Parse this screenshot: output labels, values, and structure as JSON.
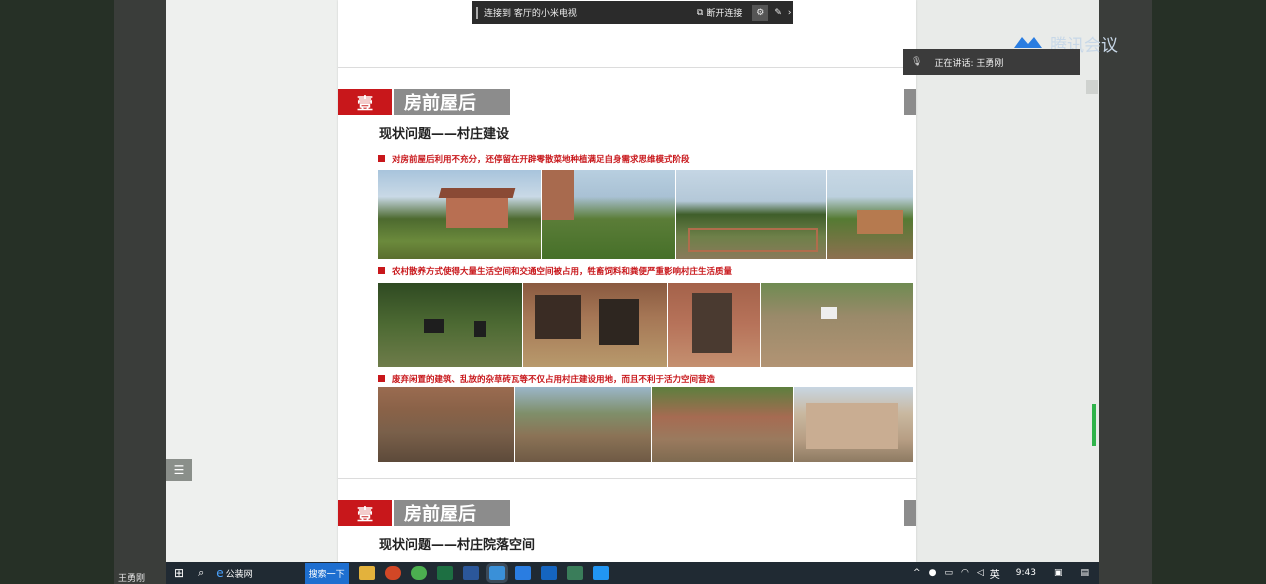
{
  "cast_bar": {
    "label": "连接到 客厅的小米电视",
    "disconnect": "断开连接"
  },
  "meeting": {
    "brand": "腾讯会议",
    "speaking_label": "正在讲话: 王勇刚",
    "user_name": "王勇刚"
  },
  "slides": [
    {
      "badge": "壹",
      "title": "房前屋后",
      "subtitle": "现状问题——村庄建设",
      "bullets": [
        "对房前屋后利用不充分，还停留在开辟零散菜地种植满足自身需求思维模式阶段",
        "农村散养方式使得大量生活空间和交通空间被占用，牲畜饲料和粪便严重影响村庄生活质量",
        "废弃闲置的建筑、乱放的杂草砖瓦等不仅占用村庄建设用地，而且不利于活力空间营造"
      ]
    },
    {
      "badge": "壹",
      "title": "房前屋后",
      "subtitle": "现状问题——村庄院落空间"
    }
  ],
  "taskbar": {
    "browser_label": "公装网",
    "search_button": "搜索一下",
    "ime": "英",
    "time": "9:43"
  },
  "colors": {
    "accent_red": "#c8171b",
    "title_gray": "#8c8c8c",
    "taskbar": "#202a33",
    "meeting_blue": "#2a7de1"
  }
}
